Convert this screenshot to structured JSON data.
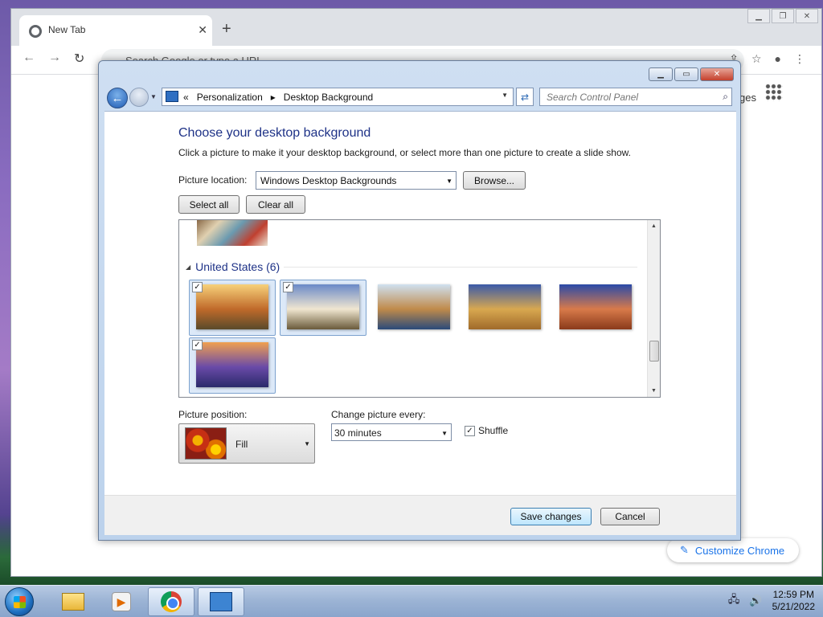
{
  "browser": {
    "tab_title": "New Tab",
    "tab_close": "✕",
    "new_tab": "+",
    "omnibox_placeholder": "Search Google or type a URL",
    "images_link": "ges",
    "customize_label": "Customize Chrome"
  },
  "window": {
    "breadcrumb": [
      "«",
      "Personalization",
      "▸",
      "Desktop Background"
    ],
    "search_placeholder": "Search Control Panel"
  },
  "content": {
    "title": "Choose your desktop background",
    "description": "Click a picture to make it your desktop background, or select more than one picture to create a slide show.",
    "picture_location_label": "Picture location:",
    "picture_location_value": "Windows Desktop Backgrounds",
    "browse_label": "Browse...",
    "select_all_label": "Select all",
    "clear_all_label": "Clear all",
    "group_label": "United States (6)",
    "pictures": [
      {
        "name": "Sunset meadow",
        "checked": true,
        "selected": true,
        "colors": [
          "#f7d17a",
          "#c06a2a",
          "#5a4a2a"
        ]
      },
      {
        "name": "Lighthouse",
        "checked": true,
        "selected": true,
        "colors": [
          "#6a8ac8",
          "#f0e6d0",
          "#6a5a3a"
        ]
      },
      {
        "name": "Rock arch coast",
        "checked": false,
        "selected": false,
        "colors": [
          "#cfe0f0",
          "#c08a4a",
          "#2a4a7a"
        ]
      },
      {
        "name": "Hay bale",
        "checked": false,
        "selected": false,
        "colors": [
          "#3a5aa8",
          "#d8a850",
          "#a06a2a"
        ]
      },
      {
        "name": "Delicate arch",
        "checked": false,
        "selected": false,
        "colors": [
          "#2a4aa8",
          "#d87a4a",
          "#8a3a1a"
        ]
      },
      {
        "name": "Lupine lake",
        "checked": true,
        "selected": true,
        "colors": [
          "#f0a050",
          "#6a4aa8",
          "#2a2a6a"
        ]
      }
    ],
    "checkmark": "✓",
    "picture_position_label": "Picture position:",
    "picture_position_value": "Fill",
    "change_picture_label": "Change picture every:",
    "change_picture_value": "30 minutes",
    "shuffle_label": "Shuffle",
    "shuffle_checked": true
  },
  "footer": {
    "save_label": "Save changes",
    "cancel_label": "Cancel"
  },
  "taskbar": {
    "time": "12:59 PM",
    "date": "5/21/2022"
  }
}
